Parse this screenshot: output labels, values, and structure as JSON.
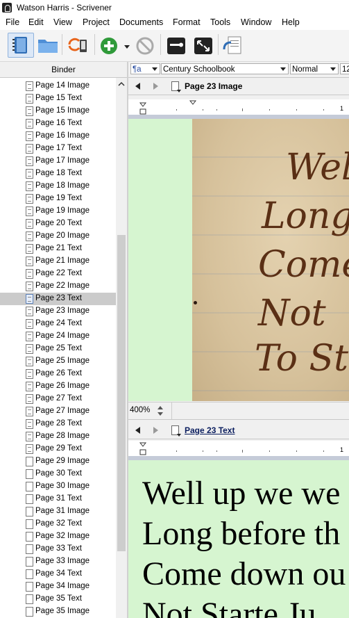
{
  "window": {
    "title": "Watson Harris - Scrivener"
  },
  "menu": [
    "File",
    "Edit",
    "View",
    "Project",
    "Documents",
    "Format",
    "Tools",
    "Window",
    "Help"
  ],
  "binder": {
    "header": "Binder",
    "selected_index": 17,
    "items": [
      "Page 14 Image",
      "Page 15 Text",
      "Page 15 Image",
      "Page 16 Text",
      "Page 16 Image",
      "Page 17 Text",
      "Page 17 Image",
      "Page 18 Text",
      "Page 18 Image",
      "Page 19 Text",
      "Page 19 Image",
      "Page 20 Text",
      "Page 20 Image",
      "Page 21 Text",
      "Page 21 Image",
      "Page 22 Text",
      "Page 22 Image",
      "Page 23 Text",
      "Page 23 Image",
      "Page 24 Text",
      "Page 24 Image",
      "Page 25 Text",
      "Page 25 Image",
      "Page 26 Text",
      "Page 26 Image",
      "Page 27 Text",
      "Page 27 Image",
      "Page 28 Text",
      "Page 28 Image",
      "Page 29 Text",
      "Page 29 Image",
      "Page 30 Text",
      "Page 30 Image",
      "Page 31 Text",
      "Page 31 Image",
      "Page 32 Text",
      "Page 32 Image",
      "Page 33 Text",
      "Page 33 Image",
      "Page 34 Text",
      "Page 34 Image",
      "Page 35 Text",
      "Page 35 Image"
    ]
  },
  "format_bar": {
    "style_icon": "¶a",
    "font": "Century Schoolbook",
    "typeface": "Normal",
    "size": "12"
  },
  "editor_top": {
    "title": "Page 23 Image",
    "ruler_mark": "1",
    "zoom": "400%",
    "handwriting": [
      "Well",
      "Long",
      "Come",
      "Not",
      "To Sta"
    ]
  },
  "editor_bottom": {
    "title": "Page 23 Text",
    "ruler_mark": "1",
    "lines": [
      "Well up we we",
      "Long before th",
      "Come down ou",
      "Not Starte Ju"
    ]
  },
  "colors": {
    "editor_bg": "#d6f5d0",
    "selection": "#cbcbcb"
  }
}
